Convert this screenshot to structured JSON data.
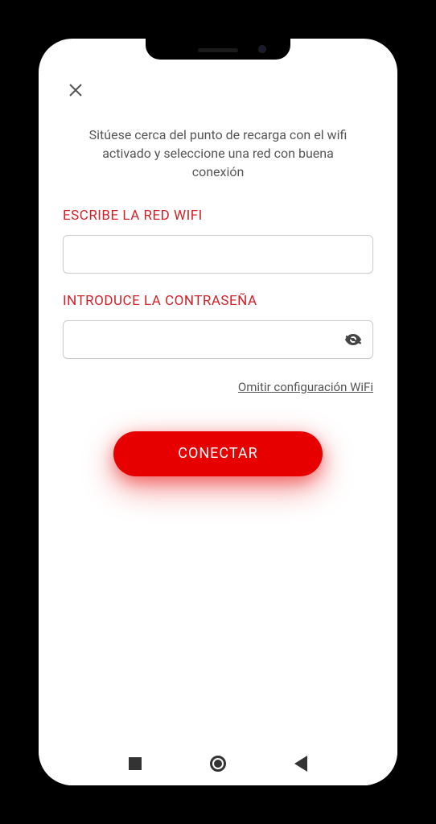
{
  "instructions": "Sitúese cerca del punto de recarga con el wifi activado y seleccione una red con buena conexión",
  "wifi": {
    "label": "ESCRIBE LA RED WIFI",
    "value": ""
  },
  "password": {
    "label": "INTRODUCE LA CONTRASEÑA",
    "value": ""
  },
  "skip_link": "Omitir configuración WiFi",
  "connect_button": "CONECTAR"
}
